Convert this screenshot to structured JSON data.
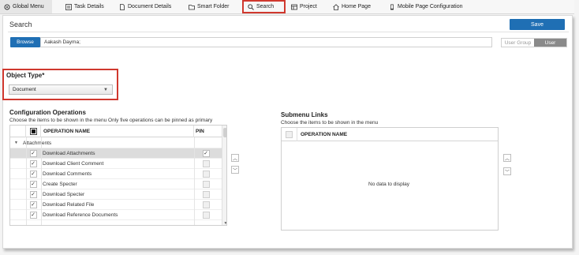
{
  "tabs": [
    {
      "label": "Global Menu",
      "icon": "gear-circle-icon"
    },
    {
      "label": "Task Details",
      "icon": "task-list-icon"
    },
    {
      "label": "Document Details",
      "icon": "document-icon"
    },
    {
      "label": "Smart Folder",
      "icon": "folder-icon"
    },
    {
      "label": "Search",
      "icon": "search-icon"
    },
    {
      "label": "Project",
      "icon": "project-icon"
    },
    {
      "label": "Home Page",
      "icon": "home-icon"
    },
    {
      "label": "Mobile Page Configuration",
      "icon": "mobile-icon"
    }
  ],
  "header": {
    "title": "Search",
    "save_label": "Save"
  },
  "browse": {
    "button_label": "Browse",
    "value": "Aakash Dayma;"
  },
  "toggle": {
    "user_group": "User Group",
    "user": "User",
    "selected": "User"
  },
  "object_type": {
    "label": "Object Type*",
    "selected": "Document"
  },
  "config_ops": {
    "title": "Configuration Operations",
    "subtitle": "Choose the items to be shown in the menu Only five operations can be pinned as primary",
    "col_name": "OPERATION NAME",
    "col_pin": "PIN",
    "group": "Attachments",
    "rows": [
      {
        "name": "Download Attachments",
        "checked": true,
        "pinned": true
      },
      {
        "name": "Download Client Comment",
        "checked": true,
        "pinned": false
      },
      {
        "name": "Download Comments",
        "checked": true,
        "pinned": false
      },
      {
        "name": "Create Specter",
        "checked": true,
        "pinned": false
      },
      {
        "name": "Download Specter",
        "checked": true,
        "pinned": false
      },
      {
        "name": "Download Related File",
        "checked": true,
        "pinned": false
      },
      {
        "name": "Download Reference Documents",
        "checked": true,
        "pinned": false
      }
    ]
  },
  "submenu": {
    "title": "Submenu Links",
    "subtitle": "Choose the items to be shown in the menu",
    "col_name": "OPERATION NAME",
    "empty_text": "No data to display"
  },
  "colors": {
    "accent": "#1f6fb4",
    "highlight": "#d0382e"
  }
}
